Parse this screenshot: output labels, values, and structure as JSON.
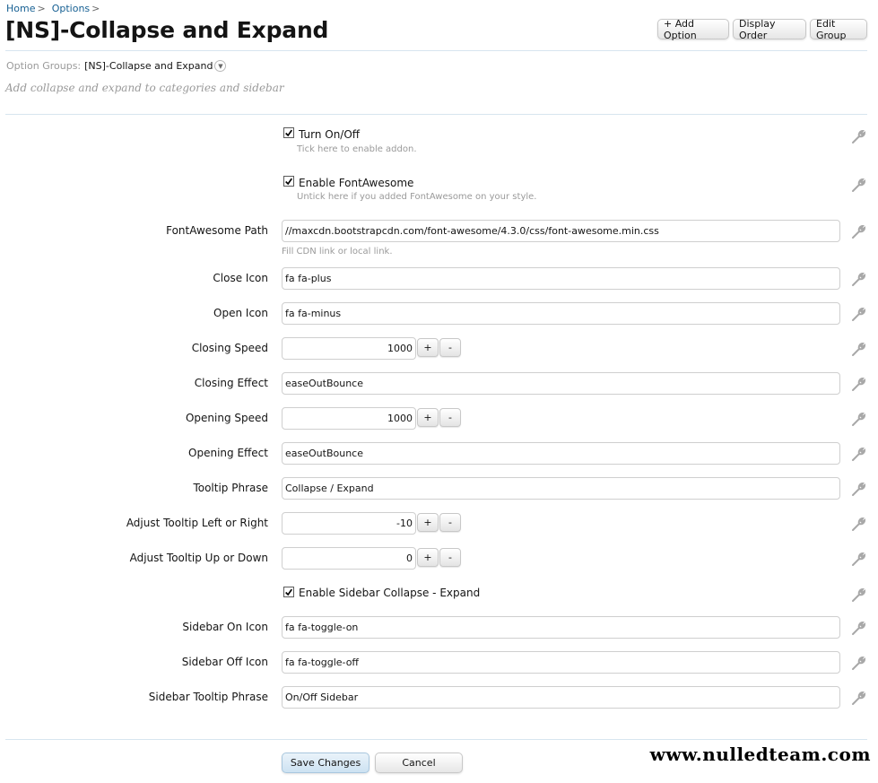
{
  "breadcrumb": [
    {
      "label": "Home",
      "sep": ">"
    },
    {
      "label": "Options",
      "sep": ">"
    }
  ],
  "page_title": "[NS]-Collapse and Expand",
  "toolbar": {
    "add_option": "+ Add Option",
    "display_order": "Display Order",
    "edit_group": "Edit Group"
  },
  "option_group": {
    "label": "Option Groups:",
    "value": "[NS]-Collapse and Expand",
    "description": "Add collapse and expand to categories and sidebar"
  },
  "options": {
    "turn_on_off": {
      "label": "Turn On/Off",
      "hint": "Tick here to enable addon.",
      "checked": true
    },
    "enable_fontawesome": {
      "label": "Enable FontAwesome",
      "hint": "Untick here if you added FontAwesome on your style.",
      "checked": true
    },
    "fontawesome_path": {
      "label": "FontAwesome Path",
      "value": "//maxcdn.bootstrapcdn.com/font-awesome/4.3.0/css/font-awesome.min.css",
      "hint": "Fill CDN link or local link."
    },
    "close_icon": {
      "label": "Close Icon",
      "value": "fa fa-plus"
    },
    "open_icon": {
      "label": "Open Icon",
      "value": "fa fa-minus"
    },
    "closing_speed": {
      "label": "Closing Speed",
      "value": "1000"
    },
    "closing_effect": {
      "label": "Closing Effect",
      "value": "easeOutBounce"
    },
    "opening_speed": {
      "label": "Opening Speed",
      "value": "1000"
    },
    "opening_effect": {
      "label": "Opening Effect",
      "value": "easeOutBounce"
    },
    "tooltip_phrase": {
      "label": "Tooltip Phrase",
      "value": "Collapse / Expand"
    },
    "tooltip_left_right": {
      "label": "Adjust Tooltip Left or Right",
      "value": "-10"
    },
    "tooltip_up_down": {
      "label": "Adjust Tooltip Up or Down",
      "value": "0"
    },
    "enable_sidebar": {
      "label": "Enable Sidebar Collapse - Expand",
      "checked": true
    },
    "sidebar_on_icon": {
      "label": "Sidebar On Icon",
      "value": "fa fa-toggle-on"
    },
    "sidebar_off_icon": {
      "label": "Sidebar Off Icon",
      "value": "fa fa-toggle-off"
    },
    "sidebar_tooltip": {
      "label": "Sidebar Tooltip Phrase",
      "value": "On/Off Sidebar"
    }
  },
  "spinner": {
    "plus": "+",
    "minus": "-"
  },
  "footer": {
    "save": "Save Changes",
    "cancel": "Cancel"
  },
  "watermark": "www.nulledteam.com",
  "colors": {
    "link": "#176093",
    "divider": "#d7e5ef",
    "muted": "#9a9a9a",
    "edit_icon": "#b0b0b0"
  }
}
